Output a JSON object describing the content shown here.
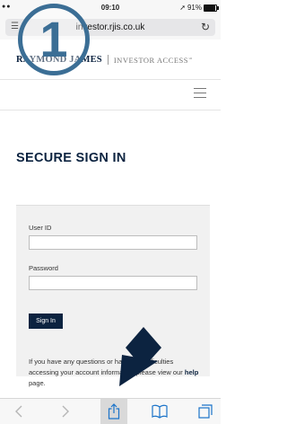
{
  "status_bar": {
    "signal": "●●",
    "time": "09:10",
    "location": "➚",
    "battery": "91%"
  },
  "address_bar": {
    "url": "investor.rjis.co.uk"
  },
  "header": {
    "logo_main": "RAYMOND JAMES",
    "logo_sub": "INVESTOR ACCESS",
    "logo_mark": "℠"
  },
  "page": {
    "title": "SECURE SIGN IN"
  },
  "form": {
    "user_id_label": "User ID",
    "user_id_value": "",
    "password_label": "Password",
    "password_value": "",
    "signin_label": "Sign In"
  },
  "help": {
    "line1": "If you have any questions or have any difficulties",
    "line2": "accessing your account information please view our",
    "link": "help",
    "suffix": " page."
  },
  "overlay": {
    "step_number": "1"
  },
  "colors": {
    "brand_navy": "#0c2340",
    "badge_blue": "#3b6e95",
    "arrow_navy": "#0c2340"
  },
  "toolbar_icons": [
    "back-icon",
    "forward-icon",
    "share-icon",
    "bookmarks-icon",
    "tabs-icon"
  ]
}
